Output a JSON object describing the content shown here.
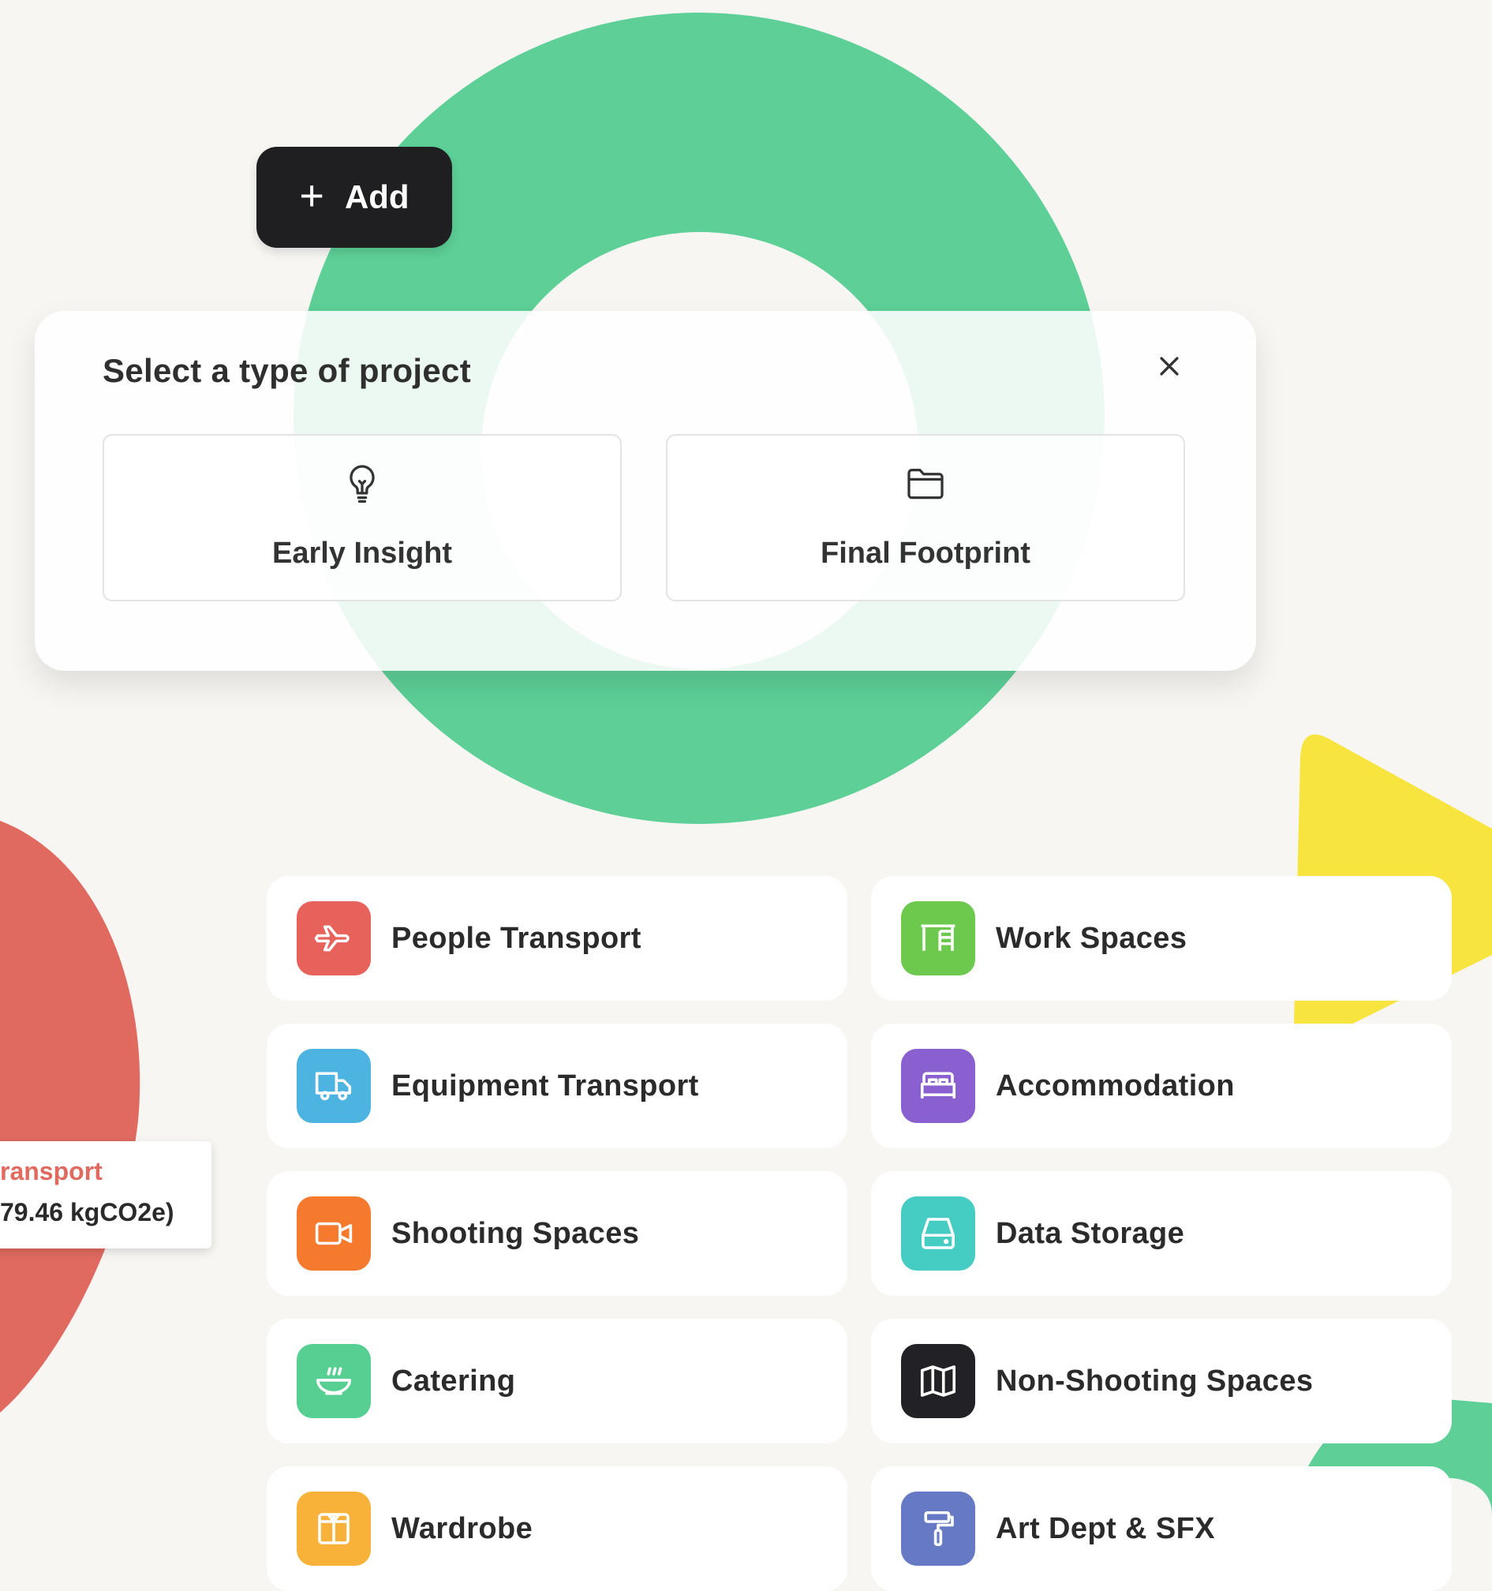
{
  "add_button": {
    "icon": "plus-icon",
    "label": "Add"
  },
  "modal": {
    "title": "Select a type of project",
    "close_icon": "close-icon",
    "options": [
      {
        "label": "Early Insight",
        "icon": "lightbulb-icon"
      },
      {
        "label": "Final Footprint",
        "icon": "folder-icon"
      }
    ]
  },
  "tooltip": {
    "category": "ransport",
    "value": "79.46 kgCO2e)"
  },
  "categories": [
    {
      "label": "People Transport",
      "icon": "plane-icon",
      "color": "#e8625c"
    },
    {
      "label": "Work Spaces",
      "icon": "desk-icon",
      "color": "#6cc94e"
    },
    {
      "label": "Equipment Transport",
      "icon": "truck-icon",
      "color": "#4db3e0"
    },
    {
      "label": "Accommodation",
      "icon": "bed-icon",
      "color": "#8a5fcf"
    },
    {
      "label": "Shooting Spaces",
      "icon": "video-camera-icon",
      "color": "#f57a2e"
    },
    {
      "label": "Data Storage",
      "icon": "hard-drive-icon",
      "color": "#45ccc3"
    },
    {
      "label": "Catering",
      "icon": "bowl-icon",
      "color": "#58cf92"
    },
    {
      "label": "Non-Shooting Spaces",
      "icon": "map-icon",
      "color": "#222226"
    },
    {
      "label": "Wardrobe",
      "icon": "wardrobe-icon",
      "color": "#f8b23a"
    },
    {
      "label": "Art Dept & SFX",
      "icon": "paint-roller-icon",
      "color": "#6679c4"
    }
  ],
  "decor_colors": {
    "green": "#5dcf97",
    "red": "#e06a60",
    "yellow": "#f7e43f"
  }
}
